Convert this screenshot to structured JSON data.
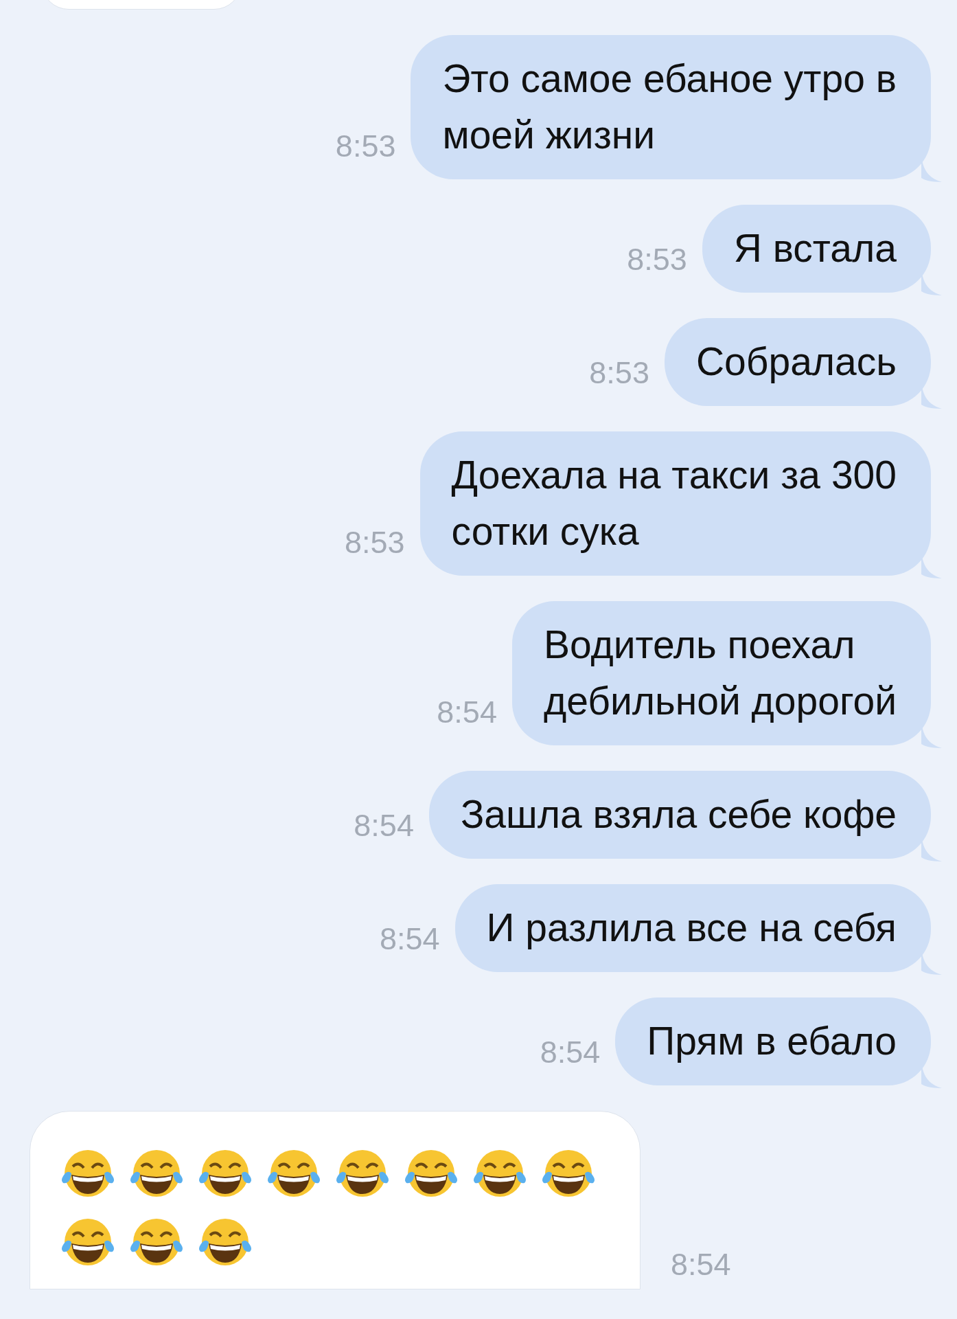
{
  "messages": [
    {
      "kind": "outgoing",
      "lines": [
        "Это самое ебаное утро в",
        "моей жизни"
      ],
      "time": "8:53"
    },
    {
      "kind": "outgoing",
      "lines": [
        "Я встала"
      ],
      "time": "8:53"
    },
    {
      "kind": "outgoing",
      "lines": [
        "Собралась"
      ],
      "time": "8:53"
    },
    {
      "kind": "outgoing",
      "lines": [
        "Доехала на такси за 300",
        "сотки сука"
      ],
      "time": "8:53"
    },
    {
      "kind": "outgoing",
      "lines": [
        "Водитель поехал",
        "дебильной дорогой"
      ],
      "time": "8:54"
    },
    {
      "kind": "outgoing",
      "lines": [
        "Зашла взяла себе кофе"
      ],
      "time": "8:54"
    },
    {
      "kind": "outgoing",
      "lines": [
        "И разлила все на себя"
      ],
      "time": "8:54"
    },
    {
      "kind": "outgoing",
      "lines": [
        "Прям в ебало"
      ],
      "time": "8:54"
    },
    {
      "kind": "incoming",
      "emoji": [
        {
          "kind": "tears-of-joy"
        },
        {
          "kind": "tears-of-joy"
        },
        {
          "kind": "tears-of-joy"
        },
        {
          "kind": "tears-of-joy"
        },
        {
          "kind": "tears-of-joy"
        },
        {
          "kind": "tears-of-joy"
        },
        {
          "kind": "tears-of-joy"
        },
        {
          "kind": "tears-of-joy"
        },
        {
          "kind": "tears-of-joy"
        },
        {
          "kind": "tears-of-joy"
        },
        {
          "kind": "tears-of-joy"
        }
      ],
      "time": "8:54"
    }
  ]
}
